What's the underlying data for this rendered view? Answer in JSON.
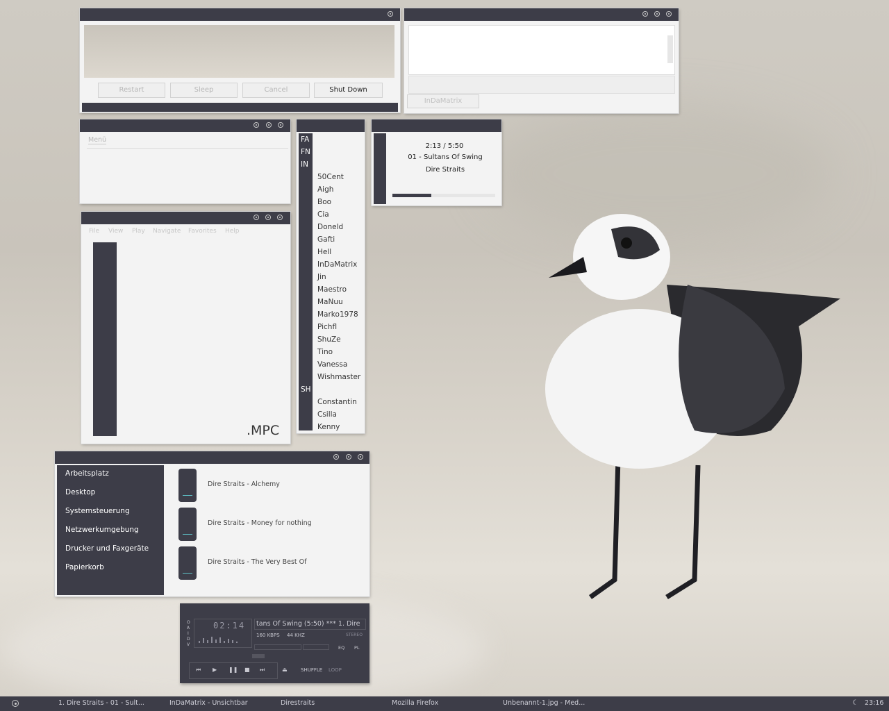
{
  "shutdown": {
    "restart": "Restart",
    "sleep": "Sleep",
    "cancel": "Cancel",
    "shutdown": "Shut Down"
  },
  "chat": {
    "tab": "InDaMatrix"
  },
  "menu_window": {
    "label": "Menü"
  },
  "mpc": {
    "menu": [
      "File",
      "View",
      "Play",
      "Navigate",
      "Favorites",
      "Help"
    ],
    "logo": ".MPC"
  },
  "contacts": {
    "groups": [
      "FA",
      "FN",
      "IN",
      "SH"
    ],
    "in_list": [
      "50Cent",
      "Aigh",
      "Boo",
      "Cia",
      "Doneld",
      "Gafti",
      "Hell",
      "InDaMatrix",
      "Jin",
      "Maestro",
      "MaNuu",
      "Marko1978",
      "Pichfl",
      "ShuZe",
      "Tino",
      "Vanessa",
      "Wishmaster"
    ],
    "sh_list": [
      "Constantin",
      "Csilla",
      "Kenny"
    ]
  },
  "nowplaying": {
    "time": "2:13 / 5:50",
    "track": "01 - Sultans Of Swing",
    "artist": "Dire Straits",
    "progress": 0.38
  },
  "places": [
    "Arbeitsplatz",
    "Desktop",
    "Systemsteuerung",
    "Netzwerkumgebung",
    "Drucker und Faxgeräte",
    "Papierkorb"
  ],
  "albums": [
    "Dire Straits - Alchemy",
    "Dire Straits - Money for nothing",
    "Dire Straits - The Very Best Of"
  ],
  "player": {
    "time": "02:14",
    "marquee": "tans Of Swing (5:50)  ***  1. Dire",
    "kbps": "160 KBPS",
    "khz": "44 KHZ",
    "stereo": "STEREO",
    "eq": "EQ",
    "pl": "PL",
    "shuffle": "SHUFFLE",
    "loop": "LOOP",
    "side": [
      "O",
      "A",
      "I",
      "D",
      "V"
    ]
  },
  "taskbar": {
    "items": [
      "1. Dire Straits - 01 - Sult...",
      "InDaMatrix - Unsichtbar",
      "Direstraits",
      "Mozilla Firefox",
      "Unbenannt-1.jpg - Med..."
    ],
    "clock": "23:16"
  },
  "colors": {
    "window_bar": "#3d3d48",
    "window_bg": "#f3f3f3",
    "accent": "#5ec2c9"
  }
}
